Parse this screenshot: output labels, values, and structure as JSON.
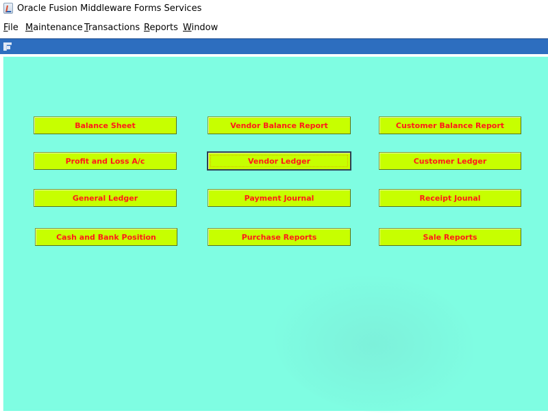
{
  "window": {
    "title": "Oracle Fusion Middleware Forms Services"
  },
  "menu": {
    "items": [
      {
        "label": "File",
        "mnemonic": "F",
        "rest": "ile"
      },
      {
        "label": "Maintenance",
        "mnemonic": "M",
        "rest": "aintenance"
      },
      {
        "label": "Transactions",
        "mnemonic": "T",
        "rest": "ransactions"
      },
      {
        "label": "Reports",
        "mnemonic": "R",
        "rest": "eports"
      },
      {
        "label": "Window",
        "mnemonic": "W",
        "rest": "indow"
      }
    ]
  },
  "form": {
    "background_color": "#7ffde2",
    "button_color": "#c7ff00",
    "button_text_color": "#ff1a1a",
    "buttons": {
      "balance_sheet": "Balance Sheet",
      "vendor_balance_report": "Vendor Balance Report",
      "customer_balance_report": "Customer Balance Report",
      "profit_and_loss": "Profit and Loss A/c",
      "vendor_ledger": "Vendor Ledger",
      "customer_ledger": "Customer Ledger",
      "general_ledger": "General Ledger",
      "payment_journal": "Payment Journal",
      "receipt_journal": "Receipt Jounal",
      "cash_and_bank_position": "Cash and Bank Position",
      "purchase_reports": "Purchase Reports",
      "sale_reports": "Sale Reports"
    },
    "focused_button": "Vendor Ledger"
  }
}
